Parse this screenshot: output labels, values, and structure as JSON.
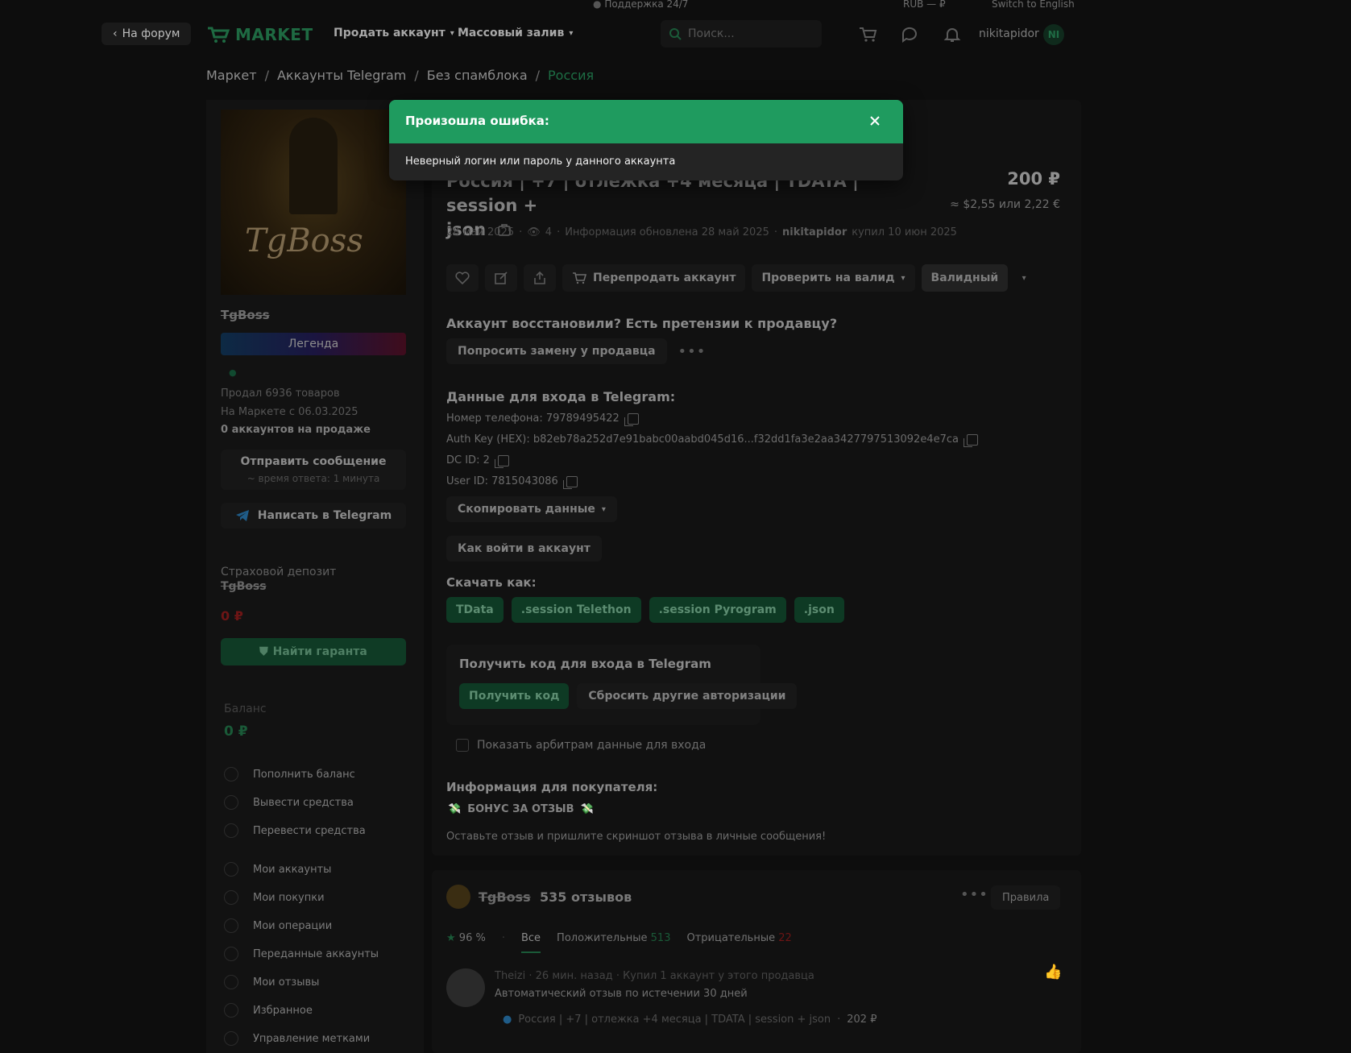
{
  "topbar": {
    "support": "Поддержка 24/7",
    "currency": "RUB — ₽",
    "language": "Switch to English"
  },
  "header": {
    "back_label": "На форум",
    "logo_text": "MARKET",
    "nav": [
      "Продать аккаунт",
      "Массовый залив"
    ],
    "search_placeholder": "Поиск...",
    "username": "nikitapidor",
    "avatar_initials": "NI"
  },
  "breadcrumb": [
    "Маркет",
    "Аккаунты Telegram",
    "Без спамблока",
    "Россия"
  ],
  "seller": {
    "cover_text": "TgBoss",
    "name": "TgBoss",
    "badge": "Легенда",
    "sold": "Продал 6936 товаров",
    "since": "На Маркете с 06.03.2025",
    "on_sale": "0 аккаунтов на продаже",
    "message_btn": "Отправить сообщение",
    "response_time": "~ время ответа: 1 минута",
    "telegram_btn": "Написать в Telegram",
    "deposit_label": "Страховой депозит",
    "deposit_name": "TgBoss",
    "deposit_value": "0 ₽",
    "guarantee_btn": "Найти гаранта",
    "balance_label": "Баланс",
    "balance_value": "0 ₽",
    "menu": [
      "Пополнить баланс",
      "Вывести средства",
      "Перевести средства",
      "Мои аккаунты",
      "Мои покупки",
      "Мои операции",
      "Переданные аккаунты",
      "Мои отзывы",
      "Избранное",
      "Управление метками"
    ]
  },
  "item": {
    "title_line1": "Россия | +7 | отлежка +4 месяца | TDATA | session +",
    "title_line2": "json",
    "price": "200 ₽",
    "price_alt": "≈ $2,55 или 2,22 €",
    "date": "28 май 2025",
    "views": "4",
    "updated": "Информация обновлена 28 май 2025",
    "buyer": "nikitapidor",
    "bought": "купил 10 июн 2025",
    "resell_btn": "Перепродать аккаунт",
    "check_btn": "Проверить на валид",
    "valid_btn": "Валидный",
    "restore_question": "Аккаунт восстановили? Есть претензии к продавцу?",
    "replace_btn": "Попросить замену у продавца",
    "login_heading": "Данные для входа в Telegram:",
    "phone": "Номер телефона: 79789495422",
    "auth_key": "Auth Key (HEX): b82eb78a252d7e91babc00aabd045d16...f32dd1fa3e2aa3427797513092e4e7ca",
    "dc_id": "DC ID: 2",
    "user_id": "User ID: 7815043086",
    "copy_btn": "Скопировать данные",
    "howto_btn": "Как войти в аккаунт",
    "download_heading": "Скачать как:",
    "downloads": [
      "TData",
      ".session Telethon",
      ".session Pyrogram",
      ".json"
    ],
    "code_heading": "Получить код для входа в Telegram",
    "get_code_btn": "Получить код",
    "reset_btn": "Сбросить другие авторизации",
    "arb_checkbox": "Показать арбитрам данные для входа",
    "buyer_info_heading": "Информация для покупателя:",
    "bonus": "БОНУС ЗА ОТЗЫВ",
    "bonus_text": "Оставьте отзыв и пришлите скриншот отзыва в личные сообщения!"
  },
  "reviews": {
    "seller_name": "TgBoss",
    "count": "535 отзывов",
    "rules_btn": "Правила",
    "rating": "96 %",
    "tab_all": "Все",
    "tab_positive": "Положительные",
    "positive_count": "513",
    "tab_negative": "Отрицательные",
    "negative_count": "22",
    "first": {
      "author": "Theizi",
      "time": "26 мин. назад",
      "action": "Купил 1 аккаунт у этого продавца",
      "text": "Автоматический отзыв по истечении 30 дней",
      "item": "Россия | +7 | отлежка +4 месяца | TDATA | session + json",
      "price": "202 ₽"
    }
  },
  "modal": {
    "title": "Произошла ошибка:",
    "message": "Неверный логин или пароль у данного аккаунта"
  },
  "colors": {
    "accent": "#1f9b5f",
    "background": "#0d0d0d",
    "negative": "#6d1515"
  }
}
